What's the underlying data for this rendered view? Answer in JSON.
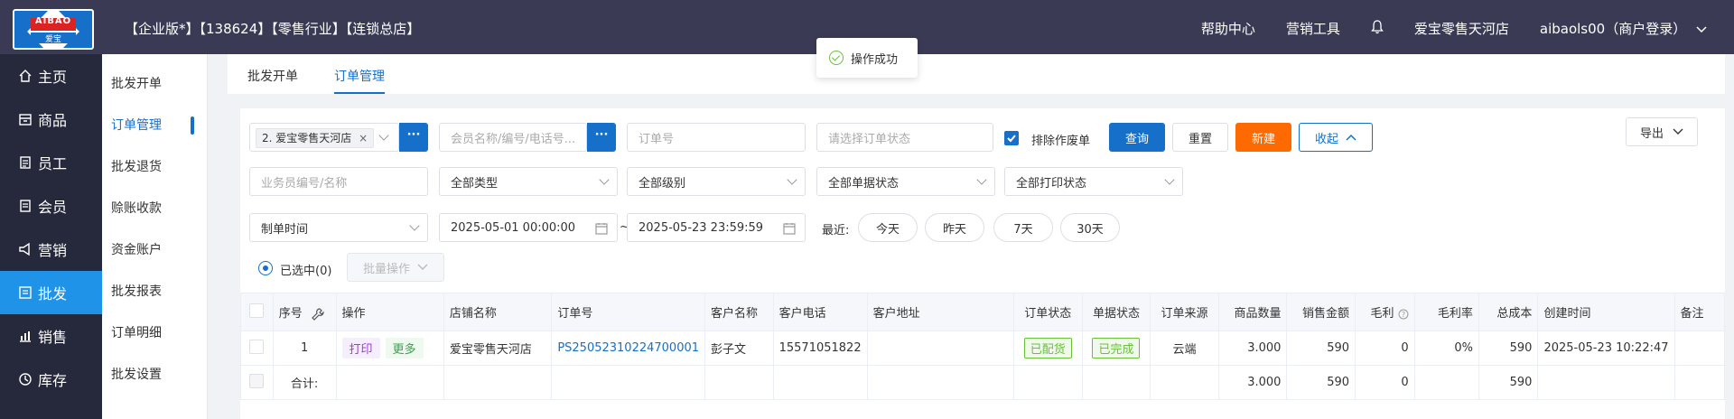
{
  "header": {
    "logo_text": "AIBAO",
    "logo_sub": "爱宝",
    "info": "【企业版*】【138624】【零售行业】【连锁总店】",
    "help": "帮助中心",
    "marketing_tools": "营销工具",
    "store": "爱宝零售天河店",
    "user": "aibaols00（商户登录）"
  },
  "sidebar": {
    "items": [
      {
        "label": "主页",
        "icon": "home-icon"
      },
      {
        "label": "商品",
        "icon": "product-icon"
      },
      {
        "label": "员工",
        "icon": "staff-icon"
      },
      {
        "label": "会员",
        "icon": "member-icon"
      },
      {
        "label": "营销",
        "icon": "megaphone-icon"
      },
      {
        "label": "批发",
        "icon": "wholesale-icon"
      },
      {
        "label": "销售",
        "icon": "chart-icon"
      },
      {
        "label": "库存",
        "icon": "stock-icon"
      }
    ],
    "active": "批发"
  },
  "subnav": {
    "items": [
      "批发开单",
      "订单管理",
      "批发退货",
      "赊账收款",
      "资金账户",
      "批发报表",
      "订单明细",
      "批发设置"
    ],
    "active": "订单管理"
  },
  "tabs": [
    "批发开单",
    "订单管理"
  ],
  "toast": "操作成功",
  "filters": {
    "store_tag": "2. 爱宝零售天河店",
    "member_placeholder": "会员名称/编号/电话号...",
    "order_no_placeholder": "订单号",
    "order_status_placeholder": "请选择订单状态",
    "exclude_void_label": "排除作废单",
    "query_btn": "查询",
    "reset_btn": "重置",
    "new_btn": "新建",
    "collapse_btn": "收起",
    "export_btn": "导出",
    "salesman_placeholder": "业务员编号/名称",
    "type_select": "全部类型",
    "level_select": "全部级别",
    "doc_status_select": "全部单据状态",
    "print_status_select": "全部打印状态",
    "time_type_select": "制单时间",
    "start_date": "2025-05-01 00:00:00",
    "tilde": "~",
    "end_date": "2025-05-23 23:59:59",
    "recent_label": "最近:",
    "quick_ranges": [
      "今天",
      "昨天",
      "7天",
      "30天"
    ],
    "selected_label": "已选中(0)",
    "batch_btn": "批量操作"
  },
  "table": {
    "headers": [
      "序号",
      "操作",
      "店铺名称",
      "订单号",
      "客户名称",
      "客户电话",
      "客户地址",
      "订单状态",
      "单据状态",
      "订单来源",
      "商品数量",
      "销售金额",
      "毛利",
      "毛利率",
      "总成本",
      "创建时间",
      "备注"
    ],
    "rows": [
      {
        "index": "1",
        "op_print": "打印",
        "op_more": "更多",
        "store": "爱宝零售天河店",
        "order_no": "PS25052310224700001",
        "customer": "彭子文",
        "phone": "15571051822",
        "address": "",
        "order_status": "已配货",
        "doc_status": "已完成",
        "source": "云端",
        "qty": "3.000",
        "amount": "590",
        "profit": "0",
        "margin": "0%",
        "cost": "590",
        "created": "2025-05-23 10:22:47",
        "remark": ""
      }
    ],
    "total": {
      "label": "合计:",
      "qty": "3.000",
      "amount": "590",
      "profit": "0",
      "cost": "590"
    }
  },
  "colors": {
    "header_bg": "#3a3a55",
    "sidebar_bg": "#26293b",
    "accent": "#1670c9",
    "new_btn": "#ff6a00",
    "success": "#67c23a"
  }
}
